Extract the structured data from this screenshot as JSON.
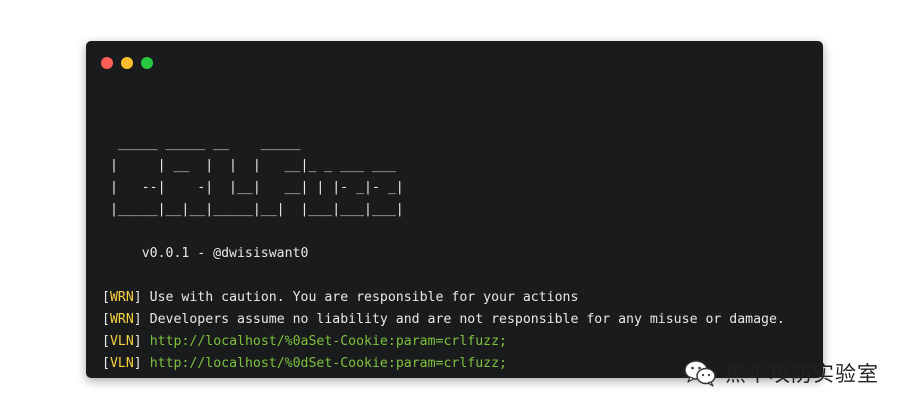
{
  "terminal": {
    "ascii_banner": "  _____ _____ __    _____\n |     | __  |  |  |   __|_ _ ___ ___\n |   --|    -|  |__|   __| | |- _|- _|\n |_____|__|__|_____|__|  |___|___|___|",
    "version_line": "     v0.0.1 - @dwisiswant0",
    "logs": [
      {
        "tag": "WRN",
        "message": " Use with caution. You are responsible for your actions",
        "url": ""
      },
      {
        "tag": "WRN",
        "message": " Developers assume no liability and are not responsible for any misuse or damage.",
        "url": ""
      },
      {
        "tag": "VLN",
        "message": " ",
        "url": "http://localhost/%0aSet-Cookie:param=crlfuzz;"
      },
      {
        "tag": "VLN",
        "message": " ",
        "url": "http://localhost/%0dSet-Cookie:param=crlfuzz;"
      }
    ]
  },
  "watermark": {
    "text": "黑伞攻防实验室",
    "icon": "wechat-icon"
  },
  "colors": {
    "terminal_bg": "#1a1b1d",
    "text": "#e8e8e8",
    "tag": "#f4d03f",
    "url": "#7cc23a",
    "close": "#ff5f57",
    "minimize": "#febc2e",
    "maximize": "#28c840"
  }
}
